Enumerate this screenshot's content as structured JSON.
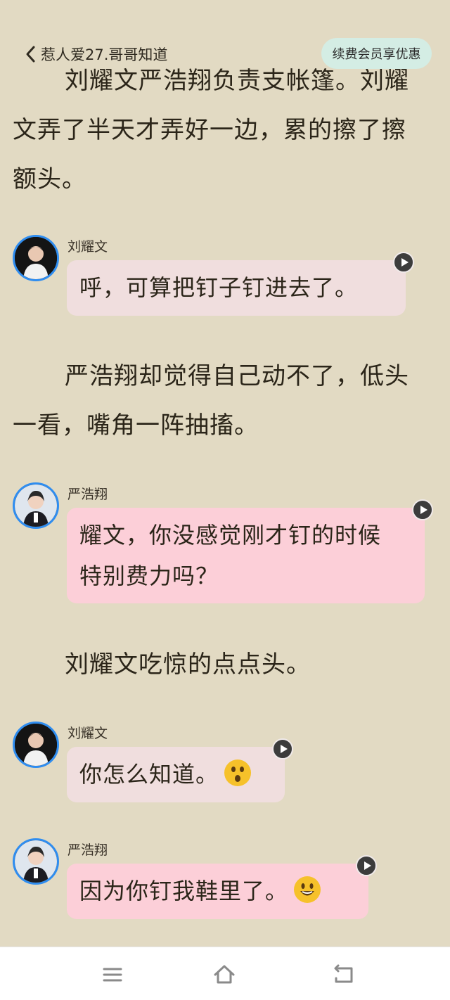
{
  "header": {
    "chapter_title": "惹人爱27.哥哥知道",
    "vip_label": "续费会员享优惠"
  },
  "content": {
    "para_top_cut": "刘耀文严浩翔负责支帐篷。刘耀",
    "para_top_line2": "文弄了半天才弄好一边，累的擦了擦",
    "para_top_line3": "额头。",
    "msg1_speaker": "刘耀文",
    "msg1_text": "呼，可算把钉子钉进去了。",
    "para2_line1": "严浩翔却觉得自己动不了，低头",
    "para2_line2": "一看，嘴角一阵抽搐。",
    "msg2_speaker": "严浩翔",
    "msg2_line1": "耀文，你没感觉刚才钉的时候",
    "msg2_line2": "特别费力吗？",
    "para3": "刘耀文吃惊的点点头。",
    "msg3_speaker": "刘耀文",
    "msg3_text": "你怎么知道。",
    "msg3_emoji": "astonished-face",
    "msg4_speaker": "严浩翔",
    "msg4_text": "因为你钉我鞋里了。",
    "msg4_emoji": "smiling-face"
  },
  "nav": {
    "menu_icon": "menu-icon",
    "home_icon": "home-icon",
    "back_icon": "back-icon"
  },
  "colors": {
    "page_background": "#e2dac3",
    "bubble_liu": "#f0dede",
    "bubble_yan": "#fccfd8",
    "vip_button": "#d4ede4",
    "avatar_ring": "#2f8df0"
  }
}
